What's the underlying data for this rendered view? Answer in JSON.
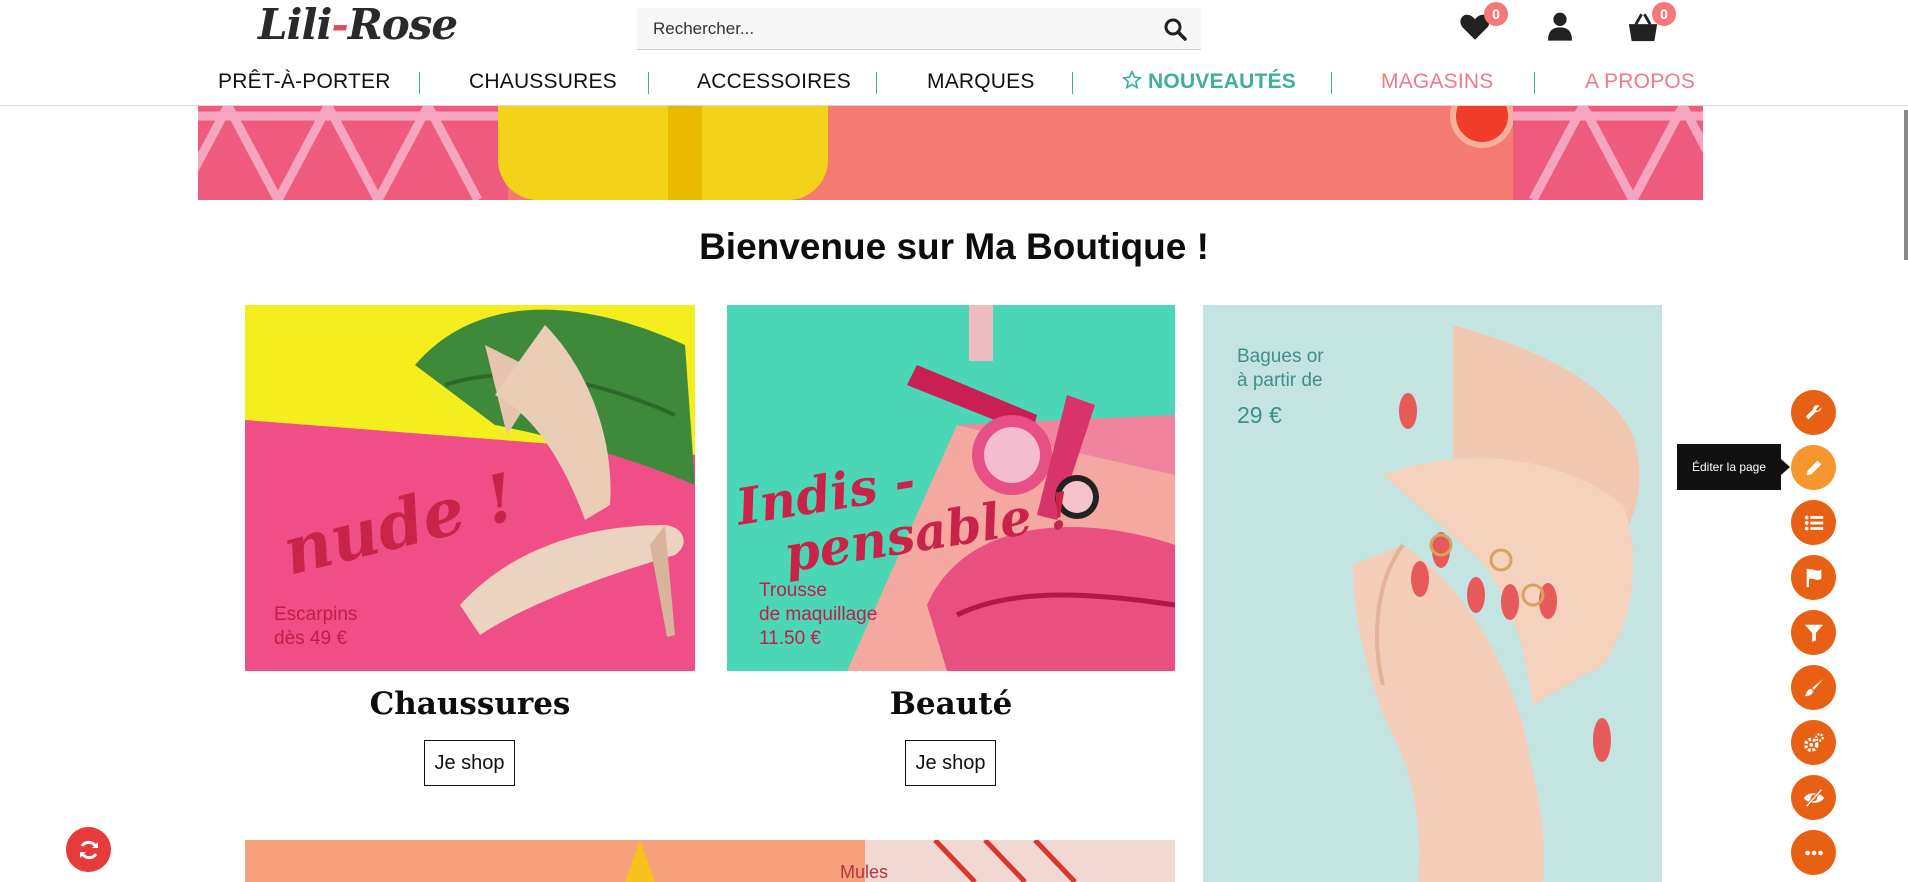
{
  "brand": {
    "logo_left": "Lili",
    "logo_dash": "-",
    "logo_right": "Rose"
  },
  "search": {
    "placeholder": "Rechercher..."
  },
  "header": {
    "wishlist_count": "0",
    "cart_count": "0"
  },
  "nav": {
    "items": [
      {
        "label": "PRÊT-À-PORTER"
      },
      {
        "label": "CHAUSSURES"
      },
      {
        "label": "ACCESSOIRES"
      },
      {
        "label": "MARQUES"
      },
      {
        "label": "NOUVEAUTÉS",
        "icon": "star-icon"
      },
      {
        "label": "MAGASINS"
      },
      {
        "label": "A PROPOS"
      }
    ]
  },
  "welcome": "Bienvenue sur Ma Boutique !",
  "cards": [
    {
      "script_text": "nude !",
      "caption_line1": "Escarpins",
      "caption_line2": "dès 49 €",
      "title": "Chaussures",
      "button": "Je shop"
    },
    {
      "script_line1": "Indis -",
      "script_line2": "pensable !",
      "caption_line1": "Trousse",
      "caption_line2": "de maquillage",
      "caption_line3": "11.50 €",
      "title": "Beauté",
      "button": "Je shop"
    },
    {
      "caption_line1": "Bagues or",
      "caption_line2": "à partir de",
      "caption_line3": "29 €"
    }
  ],
  "bottom_banner": {
    "text": "Mules"
  },
  "toolbar": {
    "tooltip": "Éditer la page",
    "tools": [
      "wrench-icon",
      "pencil-icon",
      "list-icon",
      "flag-icon",
      "filter-icon",
      "brush-icon",
      "cogs-icon",
      "eye-slash-icon",
      "more-icon"
    ]
  },
  "colors": {
    "accent_teal": "#3fae9c",
    "accent_pink": "#f07a86",
    "tool_orange": "#e86013",
    "tool_active": "#f6962e"
  }
}
